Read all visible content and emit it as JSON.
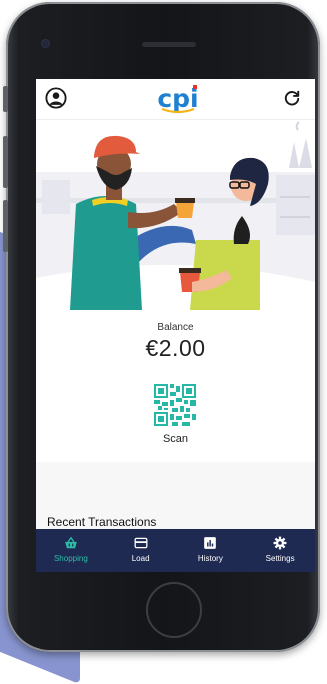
{
  "header": {
    "logo_text": "cpi"
  },
  "balance": {
    "label": "Balance",
    "amount": "€2.00"
  },
  "scan": {
    "label": "Scan"
  },
  "recent": {
    "title": "Recent Transactions"
  },
  "nav": {
    "items": [
      {
        "label": "Shopping",
        "icon": "basket-icon",
        "active": true
      },
      {
        "label": "Load",
        "icon": "card-icon",
        "active": false
      },
      {
        "label": "History",
        "icon": "chart-icon",
        "active": false
      },
      {
        "label": "Settings",
        "icon": "gear-icon",
        "active": false
      }
    ]
  },
  "colors": {
    "nav_bg": "#1f2a52",
    "nav_active": "#2fbca7",
    "nav_inactive": "#ffffff",
    "logo_blue": "#1f7fd0",
    "logo_dot": "#e8302d",
    "qr": "#27b8a5",
    "backdrop": "#8794cf"
  }
}
